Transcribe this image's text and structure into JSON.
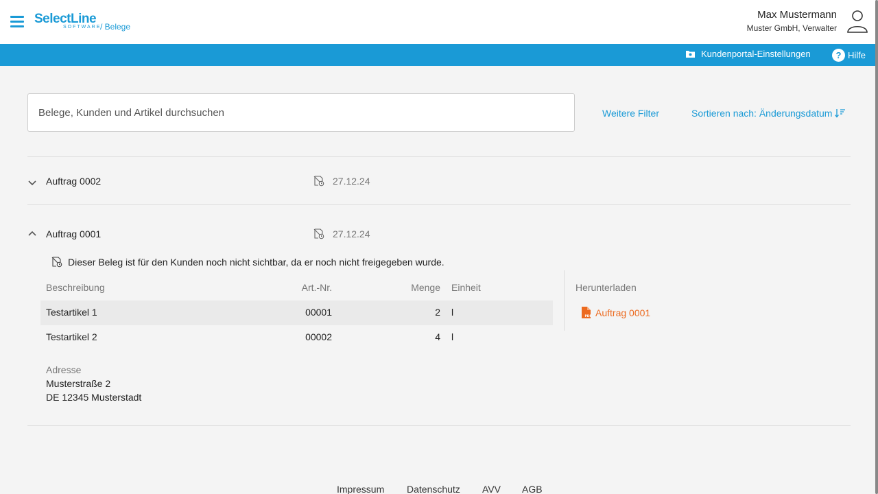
{
  "header": {
    "logo_main": "SelectLine",
    "logo_sub": "SOFTWARE",
    "breadcrumb": "/ Belege",
    "user_name": "Max Mustermann",
    "user_company": "Muster GmbH, Verwalter"
  },
  "toolbar": {
    "portal_settings": "Kundenportal-Einstellungen",
    "help": "Hilfe"
  },
  "search": {
    "placeholder": "Belege, Kunden und Artikel durchsuchen",
    "more_filters": "Weitere Filter",
    "sort_label": "Sortieren nach: Änderungsdatum"
  },
  "documents": [
    {
      "title": "Auftrag 0002",
      "date": "27.12.24",
      "expanded": false
    },
    {
      "title": "Auftrag 0001",
      "date": "27.12.24",
      "expanded": true
    }
  ],
  "detail": {
    "notice": "Dieser Beleg ist für den Kunden noch nicht sichtbar, da er noch nicht freigegeben wurde.",
    "columns": [
      "Beschreibung",
      "Art.-Nr.",
      "Menge",
      "Einheit"
    ],
    "rows": [
      {
        "description": "Testartikel 1",
        "article": "00001",
        "qty": "2",
        "unit": "l"
      },
      {
        "description": "Testartikel 2",
        "article": "00002",
        "qty": "4",
        "unit": "l"
      }
    ],
    "download_header": "Herunterladen",
    "download_link": "Auftrag 0001",
    "address_label": "Adresse",
    "address_lines": [
      "Musterstraße 2",
      "DE 12345 Musterstadt"
    ]
  },
  "footer": {
    "links": [
      "Impressum",
      "Datenschutz",
      "AVV",
      "AGB"
    ]
  },
  "colors": {
    "accent": "#1a9ad6",
    "pdf": "#ec6a1f"
  }
}
